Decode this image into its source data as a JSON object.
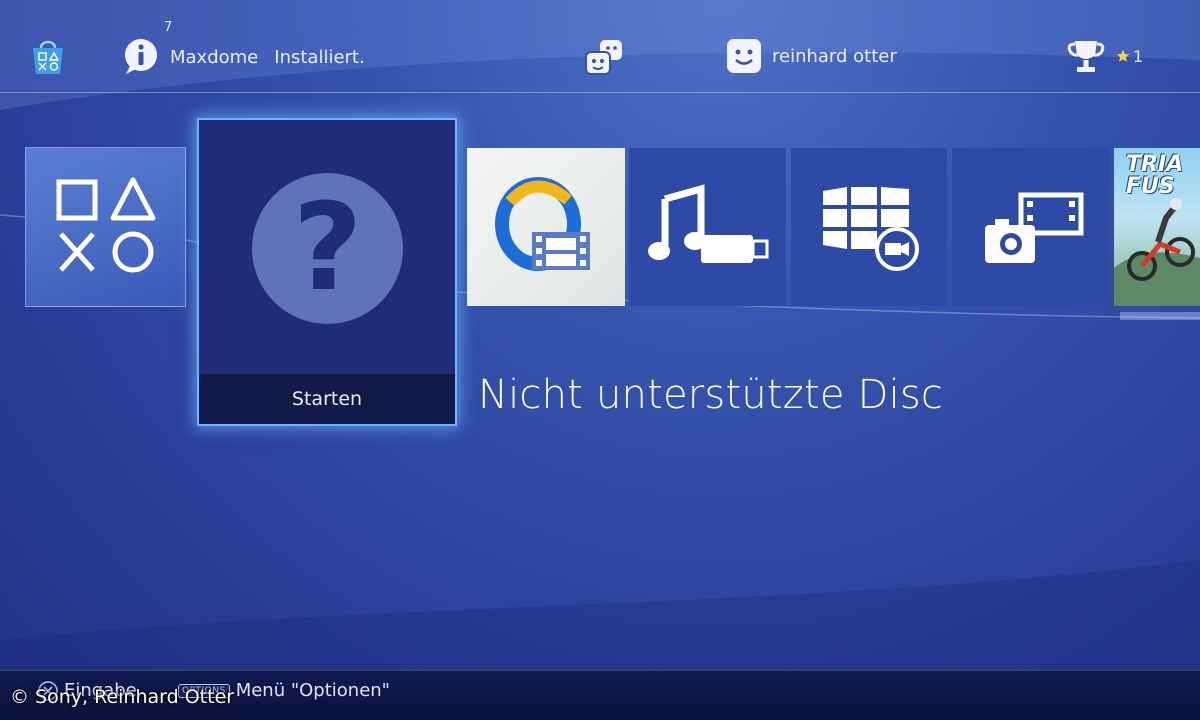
{
  "topbar": {
    "notifications_count": "7",
    "notification_app": "Maxdome",
    "notification_status": "Installiert.",
    "username": "reinhard otter",
    "trophy_level": "1"
  },
  "tiles": {
    "selected_label": "Starten",
    "game_title": "TRIA FUS"
  },
  "content": {
    "disc_title": "Nicht unterstützte Disc"
  },
  "bottombar": {
    "enter_label": "Eingabe",
    "options_badge": "OPTIONS",
    "options_label": "Menü \"Optionen\""
  },
  "watermark": {
    "copyright": "© Sony, Reinhard Otter"
  },
  "colors": {
    "background": "#2f4aa5",
    "selected_border": "#6fb3ff",
    "tile_blue": "#2d4aa6"
  }
}
